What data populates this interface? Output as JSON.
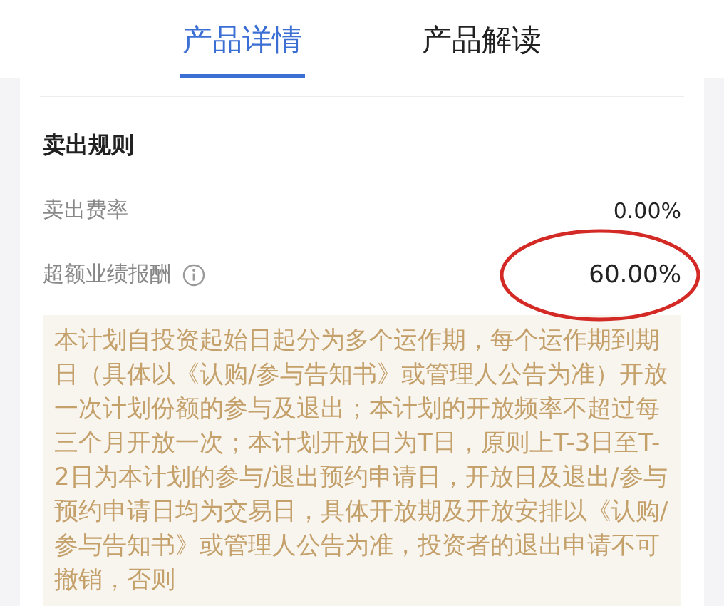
{
  "tabs": [
    {
      "label": "产品详情",
      "selected": true
    },
    {
      "label": "产品解读",
      "selected": false
    }
  ],
  "section": {
    "title": "卖出规则",
    "rows": [
      {
        "label": "卖出费率",
        "value": "0.00%",
        "info": false,
        "highlighted": false,
        "emphasis": false
      },
      {
        "label": "超额业绩报酬",
        "value": "60.00%",
        "info": true,
        "highlighted": true,
        "emphasis": true
      }
    ],
    "notice": "本计划自投资起始日起分为多个运作期，每个运作期到期日（具体以《认购/参与告知书》或管理人公告为准）开放一次计划份额的参与及退出；本计划的开放频率不超过每三个月开放一次；本计划开放日为T日，原则上T-3日至T-2日为本计划的参与/退出预约申请日，开放日及退出/参与预约申请日均为交易日，具体开放期及开放安排以《认购/参与告知书》或管理人公告为准，投资者的退出申请不可撤销，否则"
  }
}
